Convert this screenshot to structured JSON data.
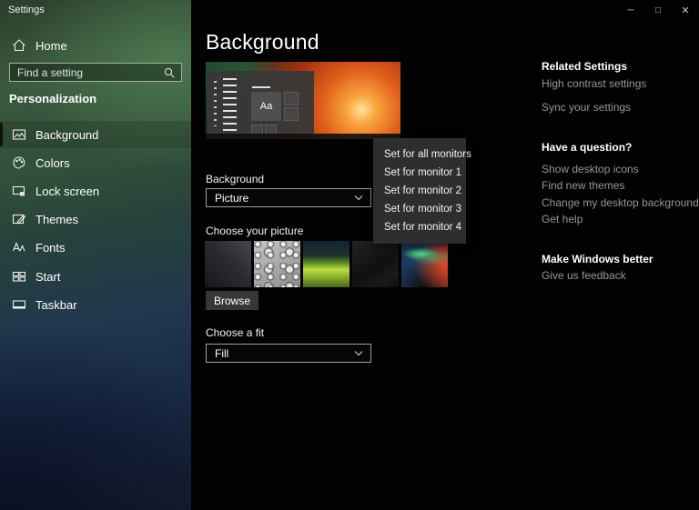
{
  "titlebar": {
    "app_title": "Settings",
    "minimize_glyph": "─",
    "maximize_glyph": "□",
    "close_glyph": "✕"
  },
  "sidebar": {
    "home": {
      "label": "Home"
    },
    "search": {
      "placeholder": "Find a setting"
    },
    "section_header": "Personalization",
    "items": [
      {
        "label": "Background",
        "selected": true
      },
      {
        "label": "Colors",
        "selected": false
      },
      {
        "label": "Lock screen",
        "selected": false
      },
      {
        "label": "Themes",
        "selected": false
      },
      {
        "label": "Fonts",
        "selected": false
      },
      {
        "label": "Start",
        "selected": false
      },
      {
        "label": "Taskbar",
        "selected": false
      }
    ]
  },
  "main": {
    "page_title": "Background",
    "preview": {
      "tile_label": "Aa"
    },
    "background_section": {
      "label": "Background",
      "selected_value": "Picture"
    },
    "picture_section": {
      "label": "Choose your picture",
      "browse_label": "Browse"
    },
    "fit_section": {
      "label": "Choose a fit",
      "selected_value": "Fill"
    }
  },
  "context_menu": {
    "items": [
      "Set for all monitors",
      "Set for monitor 1",
      "Set for monitor 2",
      "Set for monitor 3",
      "Set for monitor 4"
    ]
  },
  "right_panel": {
    "sections": [
      {
        "header": "Related Settings",
        "links": [
          "High contrast settings",
          "Sync your settings"
        ]
      },
      {
        "header": "Have a question?",
        "links": [
          "Show desktop icons",
          "Find new themes",
          "Change my desktop background",
          "Get help"
        ]
      },
      {
        "header": "Make Windows better",
        "links": [
          "Give us feedback"
        ]
      }
    ]
  },
  "colors": {
    "sidebar_green": "#3b593e",
    "sidebar_navy": "#141b2b",
    "menu_bg": "#2e2e2e",
    "link_gray": "#969696",
    "content_bg": "#020202"
  }
}
